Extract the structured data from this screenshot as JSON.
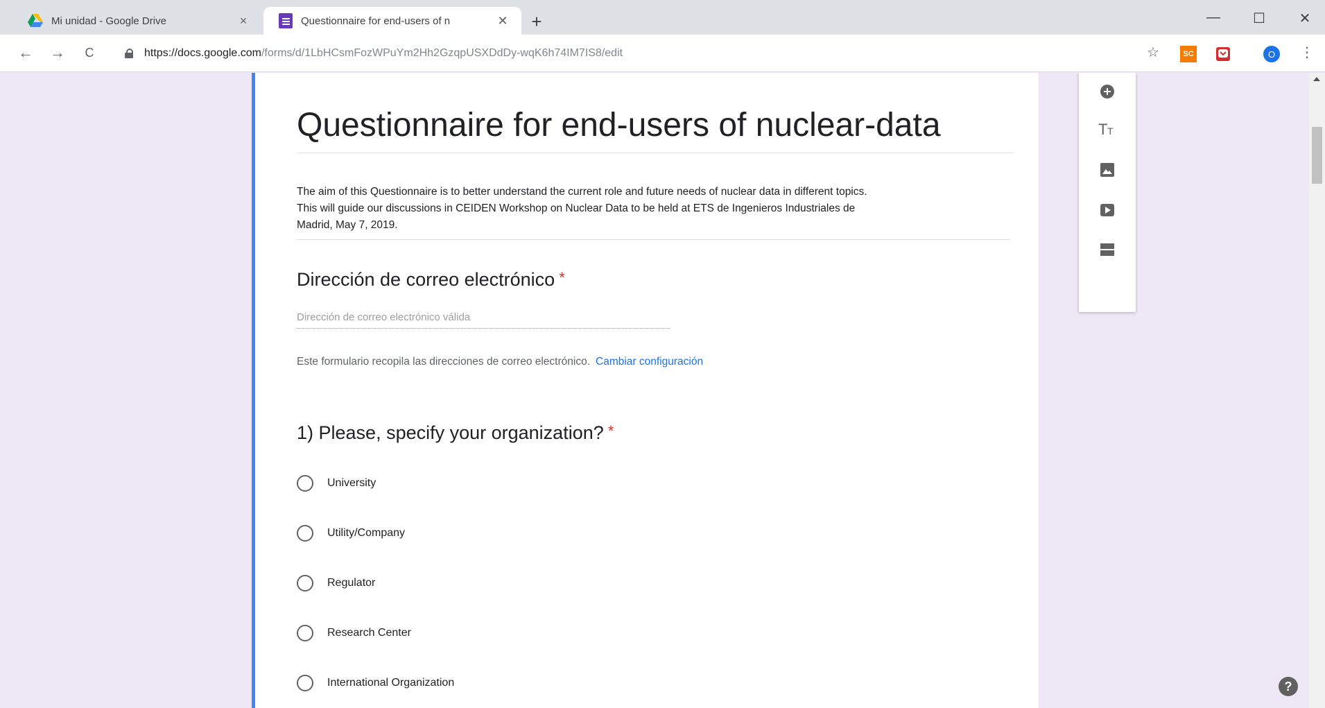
{
  "browser": {
    "tabs": [
      {
        "title": "Mi unidad - Google Drive",
        "close": "×"
      },
      {
        "title": "Questionnaire for end-users of n",
        "close": "✕"
      }
    ],
    "new_tab": "+",
    "window_controls": {
      "minimize": "—",
      "maximize": "☐",
      "close": "✕"
    },
    "nav": {
      "back": "←",
      "forward": "→",
      "reload": "C"
    },
    "url_host": "https://docs.google.com",
    "url_path": "/forms/d/1LbHCsmFozWPuYm2Hh2GzqpUSXDdDy-wqK6h74IM7IS8/edit",
    "bookmark_star": "☆",
    "extensions": [
      {
        "label": "SC",
        "color": "#f57c00"
      },
      {
        "label": "",
        "color": "#d32f2f"
      }
    ],
    "profile_initial": "O",
    "menu": "⋮"
  },
  "form": {
    "title": "Questionnaire for end-users of nuclear-data",
    "description_lines": [
      "The aim of this Questionnaire  is to better understand the current role and future needs of nuclear data in different topics.",
      "This will guide our discussions in CEIDEN Workshop on Nuclear Data to be held at ETS de Ingenieros Industriales de",
      "Madrid, May 7, 2019."
    ],
    "email_question": {
      "title": "Dirección de correo electrónico",
      "required_mark": "*",
      "placeholder": "Dirección de correo electrónico válida"
    },
    "collect_note": {
      "text": "Este formulario recopila las direcciones de correo electrónico.",
      "link": "Cambiar configuración"
    },
    "question1": {
      "title": "1) Please, specify your organization?",
      "required_mark": "*",
      "options": [
        "University",
        "Utility/Company",
        "Regulator",
        "Research Center",
        "International Organization"
      ]
    }
  },
  "side_tools": [
    "add-question-icon",
    "add-title-icon",
    "add-image-icon",
    "add-video-icon",
    "add-section-icon"
  ],
  "help": "?",
  "colors": {
    "accent": "#4285f4",
    "form_background": "#ede7f6",
    "required": "#d93025",
    "link": "#1a73e8",
    "forms_brand": "#673ab7"
  }
}
